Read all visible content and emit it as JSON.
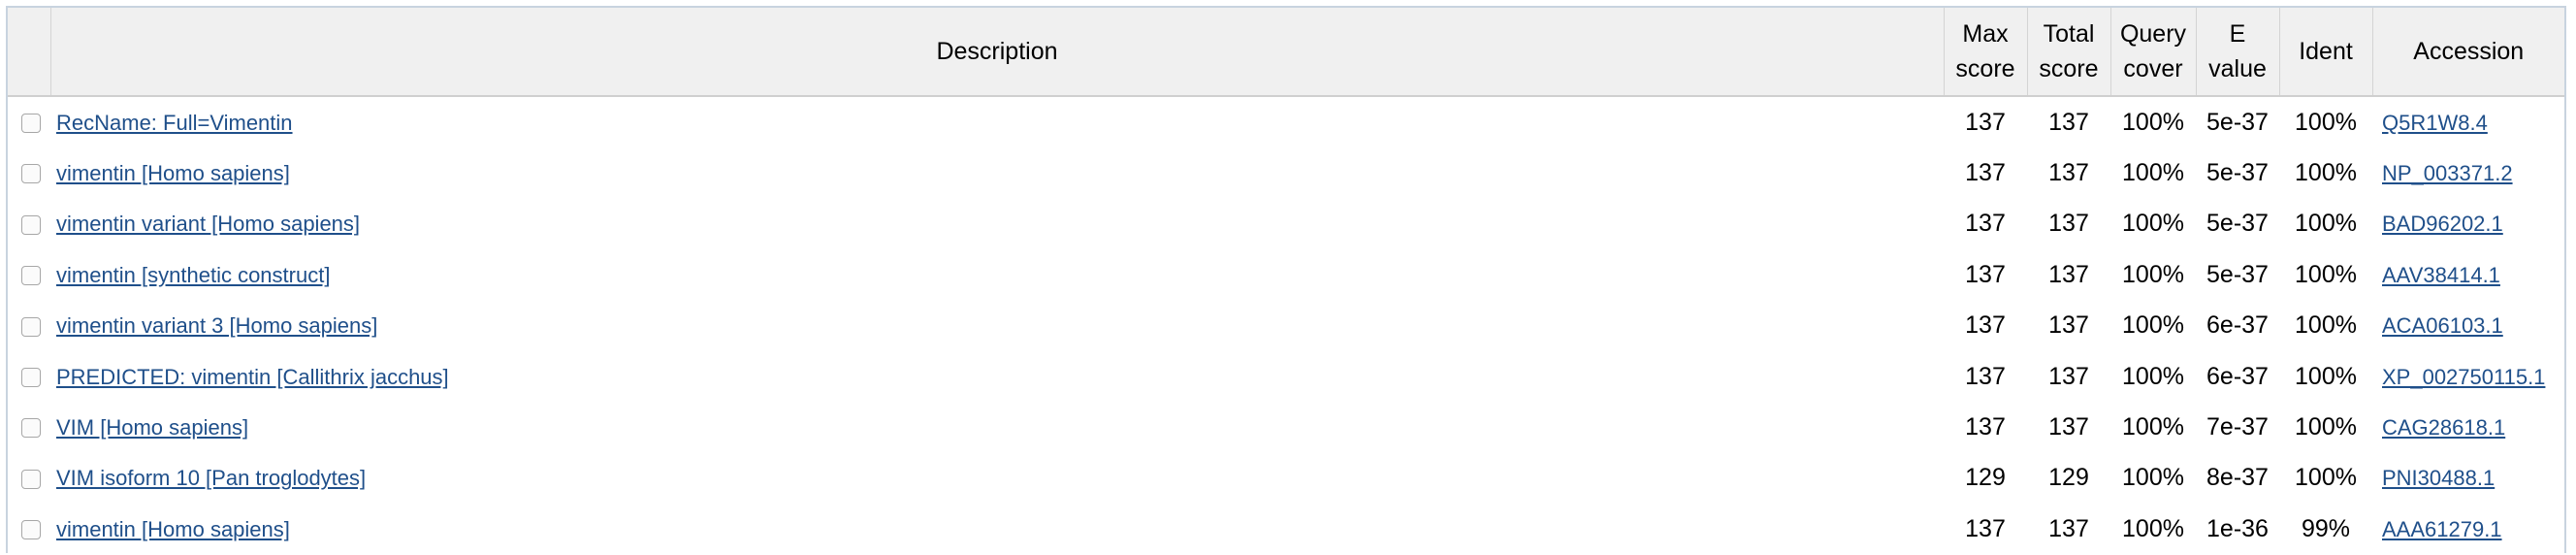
{
  "headers": {
    "description": "Description",
    "max_score_1": "Max",
    "max_score_2": "score",
    "total_score_1": "Total",
    "total_score_2": "score",
    "query_cover_1": "Query",
    "query_cover_2": "cover",
    "e_value_1": "E",
    "e_value_2": "value",
    "ident": "Ident",
    "accession": "Accession"
  },
  "rows": [
    {
      "description": "RecName: Full=Vimentin",
      "max_score": "137",
      "total_score": "137",
      "query_cover": "100%",
      "e_value": "5e-37",
      "ident": "100%",
      "accession": "Q5R1W8.4"
    },
    {
      "description": "vimentin [Homo sapiens]",
      "max_score": "137",
      "total_score": "137",
      "query_cover": "100%",
      "e_value": "5e-37",
      "ident": "100%",
      "accession": "NP_003371.2"
    },
    {
      "description": "vimentin variant [Homo sapiens]",
      "max_score": "137",
      "total_score": "137",
      "query_cover": "100%",
      "e_value": "5e-37",
      "ident": "100%",
      "accession": "BAD96202.1"
    },
    {
      "description": "vimentin [synthetic construct]",
      "max_score": "137",
      "total_score": "137",
      "query_cover": "100%",
      "e_value": "5e-37",
      "ident": "100%",
      "accession": "AAV38414.1"
    },
    {
      "description": "vimentin variant 3 [Homo sapiens]",
      "max_score": "137",
      "total_score": "137",
      "query_cover": "100%",
      "e_value": "6e-37",
      "ident": "100%",
      "accession": "ACA06103.1"
    },
    {
      "description": "PREDICTED: vimentin [Callithrix jacchus]",
      "max_score": "137",
      "total_score": "137",
      "query_cover": "100%",
      "e_value": "6e-37",
      "ident": "100%",
      "accession": "XP_002750115.1"
    },
    {
      "description": "VIM [Homo sapiens]",
      "max_score": "137",
      "total_score": "137",
      "query_cover": "100%",
      "e_value": "7e-37",
      "ident": "100%",
      "accession": "CAG28618.1"
    },
    {
      "description": "VIM isoform 10 [Pan troglodytes]",
      "max_score": "129",
      "total_score": "129",
      "query_cover": "100%",
      "e_value": "8e-37",
      "ident": "100%",
      "accession": "PNI30488.1"
    },
    {
      "description": "vimentin [Homo sapiens]",
      "max_score": "137",
      "total_score": "137",
      "query_cover": "100%",
      "e_value": "1e-36",
      "ident": "99%",
      "accession": "AAA61279.1"
    }
  ],
  "colors": {
    "link": "#1f4f8a",
    "header_bg": "#f0f0f0",
    "frame_border": "#c8d3df"
  }
}
